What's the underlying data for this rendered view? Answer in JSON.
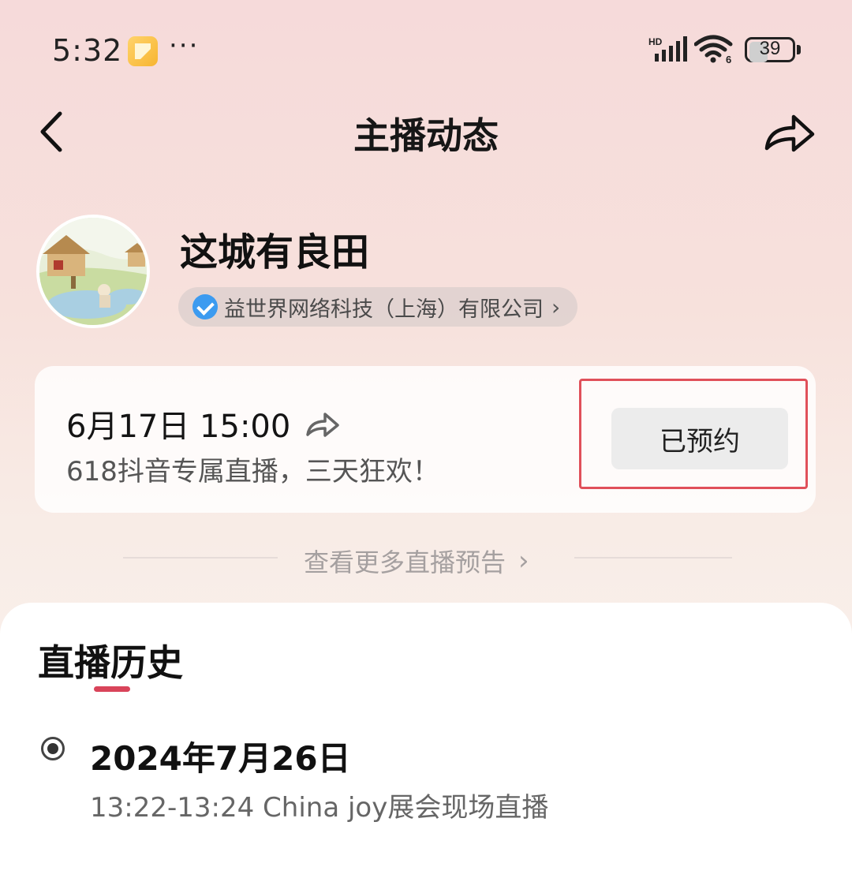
{
  "status_bar": {
    "time": "5:32",
    "more": "···",
    "battery": "39",
    "battery_level": 0.39,
    "icons": [
      "notification-app-icon",
      "signal-hd-icon",
      "wifi-6-icon",
      "battery-icon"
    ]
  },
  "nav": {
    "title": "主播动态",
    "back_icon": "chevron-left-icon",
    "share_icon": "share-arrow-icon"
  },
  "anchor": {
    "name": "这城有良田",
    "company": "益世界网络科技（上海）有限公司",
    "chevron": "›"
  },
  "preview": {
    "time": "6月17日 15:00",
    "desc": "618抖音专属直播，三天狂欢！",
    "button": "已预约"
  },
  "more_previews": {
    "label": "查看更多直播预告",
    "chevron": "›"
  },
  "history": {
    "title": "直播历史",
    "accent_color": "#d9445a",
    "items": [
      {
        "date": "2024年7月26日",
        "desc": "13:22-13:24 China joy展会现场直播"
      }
    ]
  }
}
